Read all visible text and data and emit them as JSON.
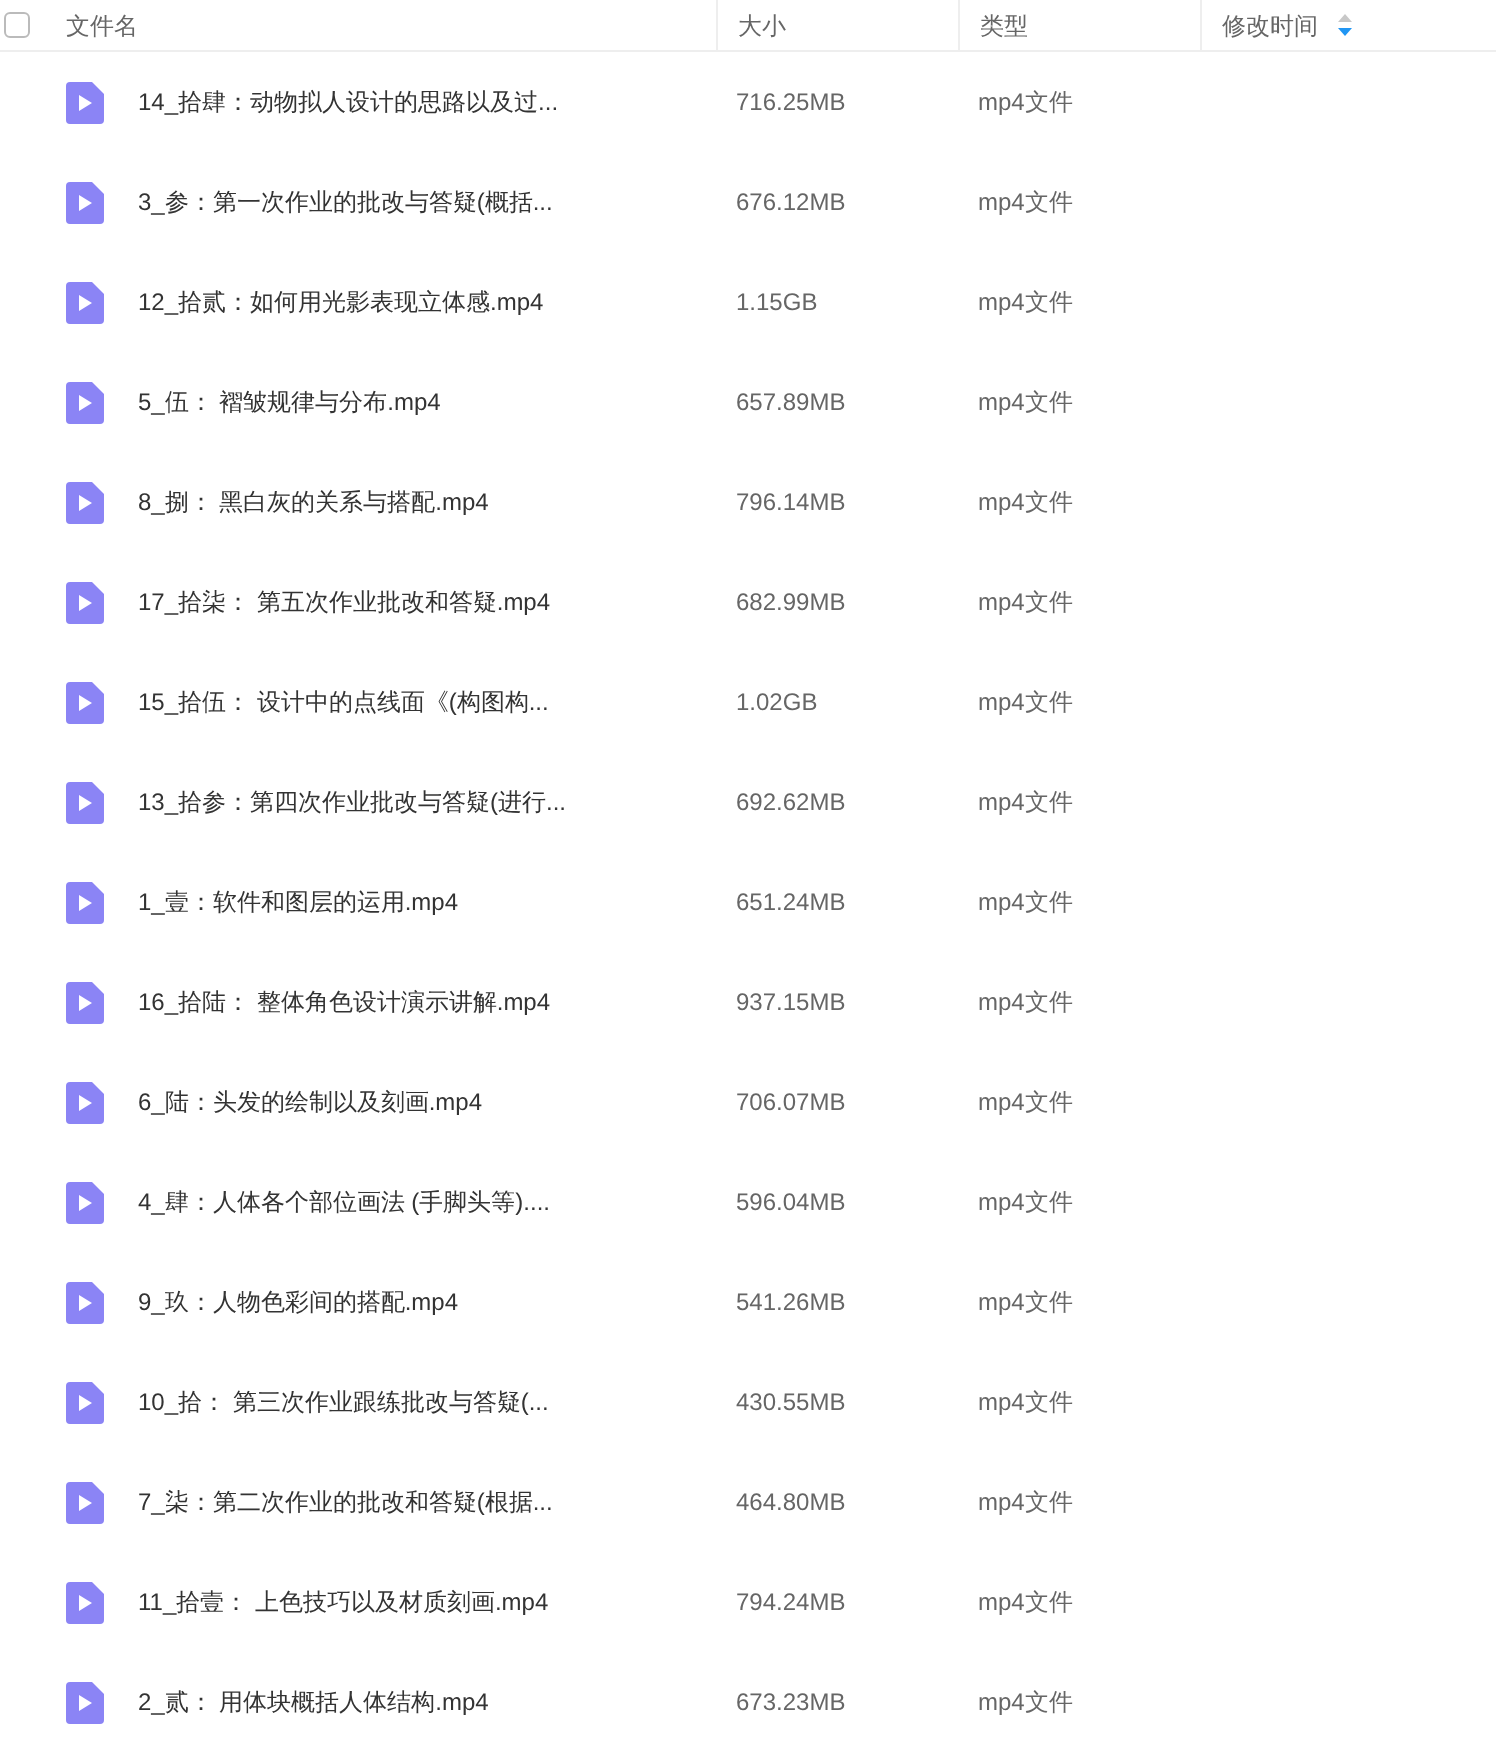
{
  "header": {
    "select_all": {
      "checked": false
    },
    "columns": [
      {
        "label": "文件名",
        "sorted": false
      },
      {
        "label": "大小",
        "sorted": false
      },
      {
        "label": "类型",
        "sorted": false
      },
      {
        "label": "修改时间",
        "sorted": true
      }
    ]
  },
  "rows": [
    {
      "name": "14_拾肆：动物拟人设计的思路以及过...",
      "size": "716.25MB",
      "type": "mp4文件"
    },
    {
      "name": "3_参：第一次作业的批改与答疑(概括...",
      "size": "676.12MB",
      "type": "mp4文件"
    },
    {
      "name": "12_拾贰：如何用光影表现立体感.mp4",
      "size": "1.15GB",
      "type": "mp4文件"
    },
    {
      "name": "5_伍： 褶皱规律与分布.mp4",
      "size": "657.89MB",
      "type": "mp4文件"
    },
    {
      "name": "8_捌： 黑白灰的关系与搭配.mp4",
      "size": "796.14MB",
      "type": "mp4文件"
    },
    {
      "name": "17_拾柒： 第五次作业批改和答疑.mp4",
      "size": "682.99MB",
      "type": "mp4文件"
    },
    {
      "name": "15_拾伍： 设计中的点线面《(构图构...",
      "size": "1.02GB",
      "type": "mp4文件"
    },
    {
      "name": "13_拾参：第四次作业批改与答疑(进行...",
      "size": "692.62MB",
      "type": "mp4文件"
    },
    {
      "name": "1_壹：软件和图层的运用.mp4",
      "size": "651.24MB",
      "type": "mp4文件"
    },
    {
      "name": "16_拾陆： 整体角色设计演示讲解.mp4",
      "size": "937.15MB",
      "type": "mp4文件"
    },
    {
      "name": "6_陆：头发的绘制以及刻画.mp4",
      "size": "706.07MB",
      "type": "mp4文件"
    },
    {
      "name": "4_肆：人体各个部位画法 (手脚头等)....",
      "size": "596.04MB",
      "type": "mp4文件"
    },
    {
      "name": "9_玖：人物色彩间的搭配.mp4",
      "size": "541.26MB",
      "type": "mp4文件"
    },
    {
      "name": "10_拾： 第三次作业跟练批改与答疑(...",
      "size": "430.55MB",
      "type": "mp4文件"
    },
    {
      "name": "7_柒：第二次作业的批改和答疑(根据...",
      "size": "464.80MB",
      "type": "mp4文件"
    },
    {
      "name": "11_拾壹： 上色技巧以及材质刻画.mp4",
      "size": "794.24MB",
      "type": "mp4文件"
    },
    {
      "name": "2_贰： 用体块概括人体结构.mp4",
      "size": "673.23MB",
      "type": "mp4文件"
    }
  ]
}
